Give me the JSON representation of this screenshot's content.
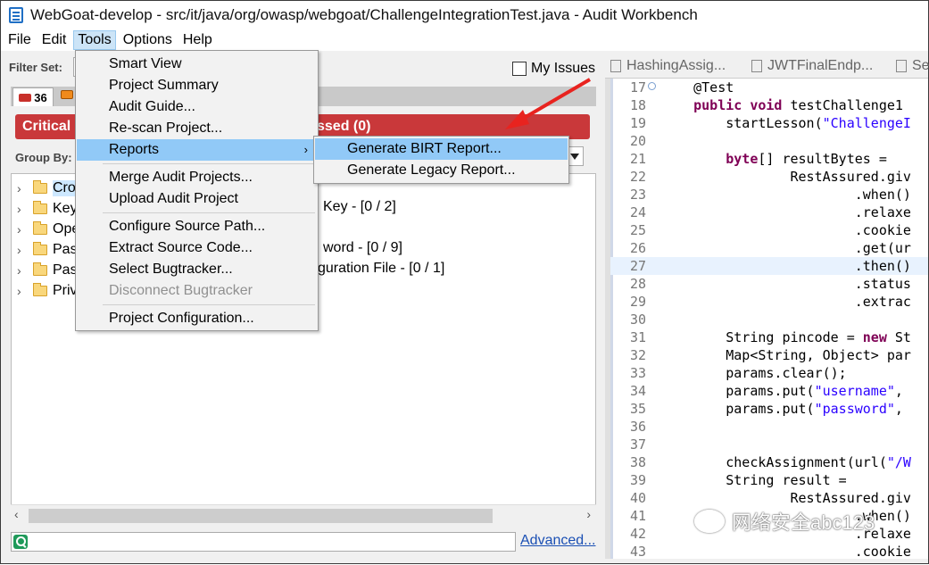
{
  "window": {
    "title": "WebGoat-develop - src/it/java/org/owasp/webgoat/ChallengeIntegrationTest.java - Audit Workbench"
  },
  "menubar": {
    "items": [
      "File",
      "Edit",
      "Tools",
      "Options",
      "Help"
    ]
  },
  "left": {
    "filter_label": "Filter Set:",
    "my_issues_label": "My Issues",
    "tab_count": "36",
    "critical_label": "Critical (",
    "status_label": "ssed (0)",
    "group_by_label": "Group By:",
    "tree": [
      {
        "label": "Cro",
        "extra": ""
      },
      {
        "label": "Key",
        "extra": "Key - [0 / 2]"
      },
      {
        "label": "Ope",
        "extra": ""
      },
      {
        "label": "Pass",
        "extra": "word - [0 / 9]"
      },
      {
        "label": "Pass",
        "extra": "figuration File - [0 / 1]"
      },
      {
        "label": "Priv",
        "extra": ""
      }
    ],
    "advanced_link": "Advanced..."
  },
  "tools_menu": {
    "items": [
      {
        "label": "Smart View"
      },
      {
        "label": "Project Summary"
      },
      {
        "label": "Audit Guide..."
      },
      {
        "label": "Re-scan Project..."
      },
      {
        "label": "Reports"
      },
      {
        "label": "Merge Audit Projects..."
      },
      {
        "label": "Upload Audit Project"
      },
      {
        "label": "Configure Source Path..."
      },
      {
        "label": "Extract Source Code..."
      },
      {
        "label": "Select Bugtracker..."
      },
      {
        "label": "Disconnect Bugtracker"
      },
      {
        "label": "Project Configuration..."
      }
    ],
    "reports_submenu": [
      "Generate BIRT Report...",
      "Generate Legacy Report..."
    ]
  },
  "editor": {
    "tabs": [
      "HashingAssig...",
      "JWTFinalEndp...",
      "Se"
    ],
    "lines": [
      {
        "n": "17",
        "html": "    @Test"
      },
      {
        "n": "18",
        "html": "    <span class='kw'>public void</span> testChallenge1"
      },
      {
        "n": "19",
        "html": "        startLesson(<span class='str'>\"ChallengeI</span>"
      },
      {
        "n": "20",
        "html": ""
      },
      {
        "n": "21",
        "html": "        <span class='kw'>byte</span>[] resultBytes ="
      },
      {
        "n": "22",
        "html": "                RestAssured.giv"
      },
      {
        "n": "23",
        "html": "                        .when()"
      },
      {
        "n": "24",
        "html": "                        .relaxe"
      },
      {
        "n": "25",
        "html": "                        .cookie"
      },
      {
        "n": "26",
        "html": "                        .get(ur"
      },
      {
        "n": "27",
        "html": "                        .then()"
      },
      {
        "n": "28",
        "html": "                        .status"
      },
      {
        "n": "29",
        "html": "                        .extrac"
      },
      {
        "n": "30",
        "html": ""
      },
      {
        "n": "31",
        "html": "        String pincode = <span class='kw'>new</span> St"
      },
      {
        "n": "32",
        "html": "        Map&lt;String, Object&gt; par"
      },
      {
        "n": "33",
        "html": "        params.clear();"
      },
      {
        "n": "34",
        "html": "        params.put(<span class='str'>\"username\"</span>,"
      },
      {
        "n": "35",
        "html": "        params.put(<span class='str'>\"password\"</span>,"
      },
      {
        "n": "36",
        "html": ""
      },
      {
        "n": "37",
        "html": ""
      },
      {
        "n": "38",
        "html": "        checkAssignment(url(<span class='str'>\"/W</span>"
      },
      {
        "n": "39",
        "html": "        String result ="
      },
      {
        "n": "40",
        "html": "                RestAssured.giv"
      },
      {
        "n": "41",
        "html": "                        .when()"
      },
      {
        "n": "42",
        "html": "                        .relaxe"
      },
      {
        "n": "43",
        "html": "                        .cookie"
      }
    ]
  },
  "watermark": "网络安全abc123"
}
